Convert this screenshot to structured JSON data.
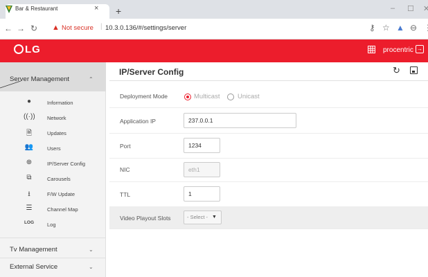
{
  "browser": {
    "tab_title": "Bar & Restaurant",
    "tab_close": "×",
    "new_tab": "+",
    "not_secure": "Not secure",
    "url": "10.3.0.136/#/settings/server",
    "window_controls": [
      "–",
      "☐",
      "✕"
    ],
    "icons": [
      "back-icon",
      "forward-icon",
      "reload-icon",
      "key-icon",
      "star-icon",
      "extension-icon",
      "account-icon",
      "menu-icon"
    ]
  },
  "header": {
    "logo": "LG",
    "user": "procentric",
    "accent": "#ec1d2c"
  },
  "sidebar": {
    "groups": [
      {
        "label": "Server Management",
        "expanded": true
      },
      {
        "label": "Tv Management",
        "expanded": false
      },
      {
        "label": "External Service",
        "expanded": false
      }
    ],
    "items": [
      {
        "label": "Information",
        "icon": "info-icon"
      },
      {
        "label": "Network",
        "icon": "antenna-icon"
      },
      {
        "label": "Updates",
        "icon": "download-file-icon"
      },
      {
        "label": "Users",
        "icon": "users-icon"
      },
      {
        "label": "IP/Server Config",
        "icon": "globe-icon"
      },
      {
        "label": "Carousels",
        "icon": "carousel-icon"
      },
      {
        "label": "F/W Update",
        "icon": "download-icon"
      },
      {
        "label": "Channel Map",
        "icon": "list-icon"
      },
      {
        "label": "Log",
        "icon": "log-icon",
        "icon_text": "LOG"
      }
    ]
  },
  "main": {
    "title": "IP/Server Config",
    "fields": {
      "deployment_mode": {
        "label": "Deployment Mode",
        "options": [
          "Multicast",
          "Unicast"
        ],
        "selected": "Multicast"
      },
      "application_ip": {
        "label": "Application IP",
        "value": "237.0.0.1"
      },
      "port": {
        "label": "Port",
        "value": "1234"
      },
      "nic": {
        "label": "NIC",
        "value": "eth1"
      },
      "ttl": {
        "label": "TTL",
        "value": "1"
      },
      "video_playout_slots": {
        "label": "Video Playout Slots",
        "value": "- Select -"
      }
    }
  }
}
